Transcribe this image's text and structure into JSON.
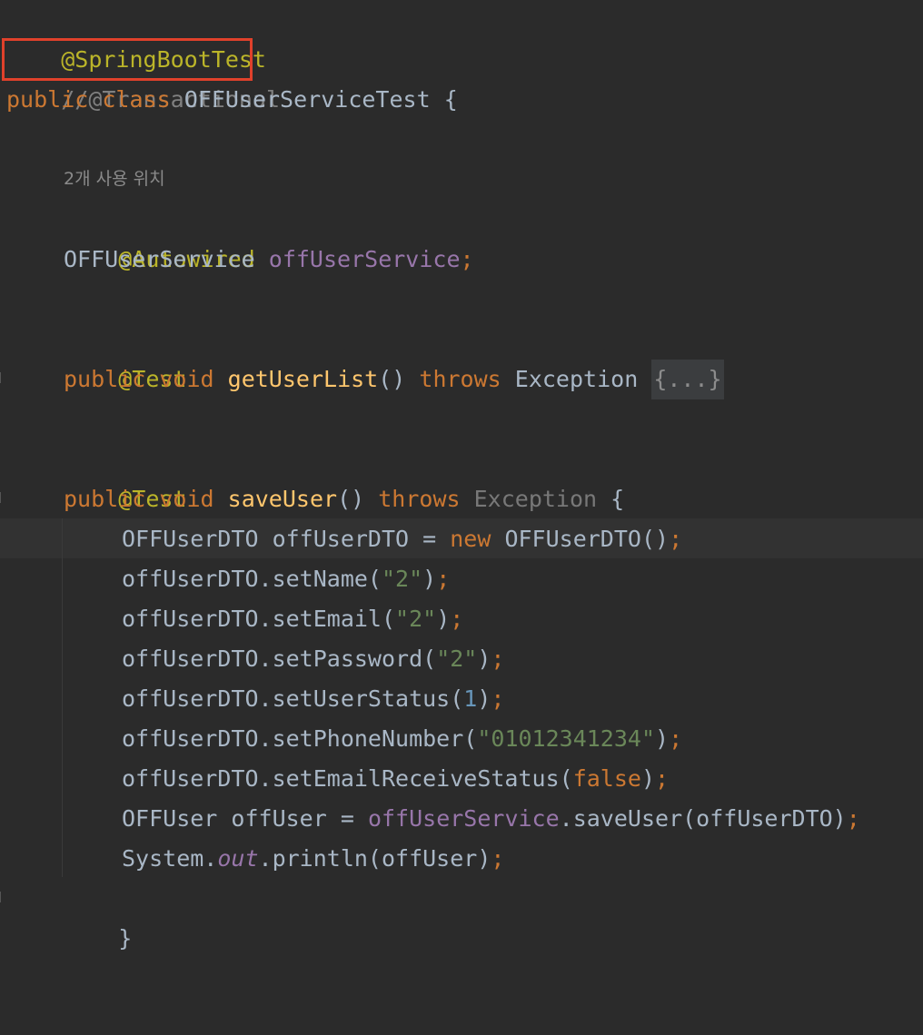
{
  "code": {
    "l1_annotation": "@SpringBootTest",
    "l2_comment": "//@Transactional",
    "l3_public": "public",
    "l3_class": "class",
    "l3_name": "OFFUserServiceTest",
    "l3_brace": "{",
    "usage_hint": "2개 사용 위치",
    "l5_annotation": "@Autowired",
    "l6_type": "OFFUserService",
    "l6_field": "offUserService",
    "l6_semi": ";",
    "l8_annotation": "@Test",
    "l9_public": "public",
    "l9_void": "void",
    "l9_method": "getUserList",
    "l9_parens": "()",
    "l9_throws": "throws",
    "l9_exception": "Exception",
    "l9_fold": "{...}",
    "l11_annotation": "@Test",
    "l12_public": "public",
    "l12_void": "void",
    "l12_method": "saveUser",
    "l12_parens": "()",
    "l12_throws": "throws",
    "l12_exception": "Exception",
    "l12_brace": "{",
    "l13_decl": "OFFUserDTO offUserDTO = ",
    "l13_new": "new",
    "l13_ctor": " OFFUserDTO()",
    "l13_semi": ";",
    "l14_call": "offUserDTO.setName(",
    "l14_arg": "\"2\"",
    "l14_close": ")",
    "l14_semi": ";",
    "l15_call": "offUserDTO.setEmail(",
    "l15_arg": "\"2\"",
    "l15_close": ")",
    "l15_semi": ";",
    "l16_call": "offUserDTO.setPassword(",
    "l16_arg": "\"2\"",
    "l16_close": ")",
    "l16_semi": ";",
    "l17_call": "offUserDTO.setUserStatus(",
    "l17_arg": "1",
    "l17_close": ")",
    "l17_semi": ";",
    "l18_call": "offUserDTO.setPhoneNumber(",
    "l18_arg": "\"01012341234\"",
    "l18_close": ")",
    "l18_semi": ";",
    "l19_call": "offUserDTO.setEmailReceiveStatus(",
    "l19_arg": "false",
    "l19_close": ")",
    "l19_semi": ";",
    "l20_decl": "OFFUser offUser = ",
    "l20_field": "offUserService",
    "l20_call": ".saveUser(offUserDTO)",
    "l20_semi": ";",
    "l21_system": "System.",
    "l21_out": "out",
    "l21_call": ".println(offUser)",
    "l21_semi": ";",
    "l22_brace": "}",
    "l26_brace": "}"
  },
  "colors": {
    "background": "#2b2b2b",
    "annotation": "#bbb529",
    "keyword": "#cc7832",
    "method": "#ffc66d",
    "field": "#9876aa",
    "string": "#6a8759",
    "number": "#6897bb",
    "comment": "#808080",
    "text": "#a9b7c6",
    "highlight_border": "#e0412b"
  }
}
